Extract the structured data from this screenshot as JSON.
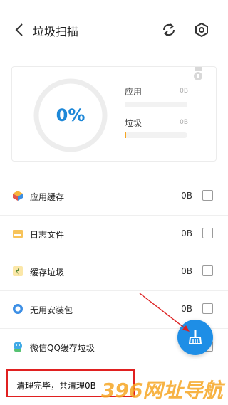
{
  "header": {
    "title": "垃圾扫描",
    "back_icon": "back-arrow-icon",
    "refresh_icon": "refresh-icon",
    "settings_icon": "settings-hexagon-icon"
  },
  "summary": {
    "percent": "0%",
    "progress_fraction": 0,
    "apps_label": "应用",
    "apps_value": "0B",
    "junk_label": "垃圾",
    "junk_value": "0B",
    "accent_color": "#1e88d8",
    "bar_color": "#f6a623"
  },
  "items": [
    {
      "label": "应用缓存",
      "size": "0B",
      "icon": "app-cache-icon"
    },
    {
      "label": "日志文件",
      "size": "0B",
      "icon": "log-file-icon"
    },
    {
      "label": "缓存垃圾",
      "size": "0B",
      "icon": "cache-junk-icon"
    },
    {
      "label": "无用安装包",
      "size": "0B",
      "icon": "apk-package-icon"
    },
    {
      "label": "微信QQ缓存垃圾",
      "size": "",
      "icon": "wechat-qq-icon"
    }
  ],
  "fab": {
    "icon": "broom-clean-icon",
    "color": "#1e8ee6"
  },
  "toast": {
    "text": "清理完毕，共清理0B"
  },
  "watermark": {
    "text": "396网址导航"
  }
}
